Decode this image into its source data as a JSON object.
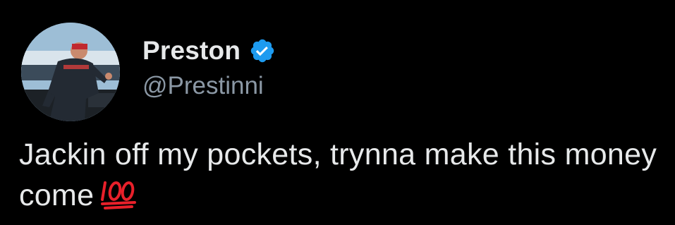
{
  "tweet": {
    "display_name": "Preston",
    "handle": "@Prestinni",
    "verified_icon": "verified-badge-icon",
    "text": "Jackin off my pockets, trynna make this money come",
    "emoji": "hundred-points-emoji"
  },
  "colors": {
    "background": "#000000",
    "text": "#e7e9ea",
    "handle": "#8b98a5",
    "verified": "#1d9bf0",
    "emoji": "#e8202a"
  }
}
